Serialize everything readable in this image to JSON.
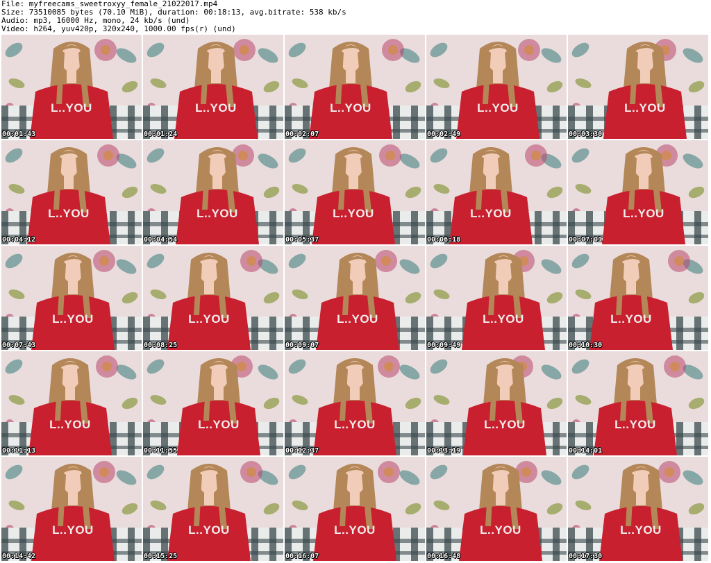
{
  "header": {
    "file_line": "File: myfreecams_sweetroxyy_female_21022017.mp4",
    "size_line": "Size: 73510085 bytes (70.10 MiB), duration: 00:18:13, avg.bitrate: 538 kb/s",
    "audio_line": "Audio: mp3, 16000 Hz, mono, 24 kb/s (und)",
    "video_line": "Video: h264, yuv420p, 320x240, 1000.00 fps(r) (und)"
  },
  "frames": [
    {
      "timestamp": "00:01:43",
      "sweater_text": "L..YOU"
    },
    {
      "timestamp": "00:01:24",
      "sweater_text": "L..YOU"
    },
    {
      "timestamp": "00:02:07",
      "sweater_text": "L..YOU"
    },
    {
      "timestamp": "00:02:49",
      "sweater_text": "L..YOU"
    },
    {
      "timestamp": "00:03:30",
      "sweater_text": "L..YOU"
    },
    {
      "timestamp": "00:04:12",
      "sweater_text": "L..YOU"
    },
    {
      "timestamp": "00:04:54",
      "sweater_text": "L..YOU"
    },
    {
      "timestamp": "00:05:37",
      "sweater_text": "L..YOU"
    },
    {
      "timestamp": "00:06:18",
      "sweater_text": "L..YOU"
    },
    {
      "timestamp": "00:07:01",
      "sweater_text": "L..YOU"
    },
    {
      "timestamp": "00:07:43",
      "sweater_text": "L..YOU"
    },
    {
      "timestamp": "00:08:25",
      "sweater_text": "L..YOU"
    },
    {
      "timestamp": "00:09:07",
      "sweater_text": "L..YOU"
    },
    {
      "timestamp": "00:09:49",
      "sweater_text": "L..YOU"
    },
    {
      "timestamp": "00:10:30",
      "sweater_text": "L..YOU"
    },
    {
      "timestamp": "00:11:13",
      "sweater_text": "L..YOU"
    },
    {
      "timestamp": "00:11:55",
      "sweater_text": "L..YOU"
    },
    {
      "timestamp": "00:12:37",
      "sweater_text": "L..YOU"
    },
    {
      "timestamp": "00:13:19",
      "sweater_text": "L..YOU"
    },
    {
      "timestamp": "00:14:01",
      "sweater_text": "L..YOU"
    },
    {
      "timestamp": "00:14:42",
      "sweater_text": "L..YOU"
    },
    {
      "timestamp": "00:15:25",
      "sweater_text": "L..YOU"
    },
    {
      "timestamp": "00:16:07",
      "sweater_text": "L..YOU"
    },
    {
      "timestamp": "00:16:48",
      "sweater_text": "L..YOU"
    },
    {
      "timestamp": "00:17:30",
      "sweater_text": "L..YOU"
    }
  ],
  "colors": {
    "wallpaper": "#eadcdc",
    "leaf_teal": "#6e9a98",
    "flower_magenta": "#b8476f",
    "leaf_olive": "#9aa55a",
    "sweater_red": "#c8202f",
    "hair": "#b48758",
    "skin": "#f1cdb9",
    "couch_dark": "#3a4a4c",
    "couch_light": "#e9eceb"
  }
}
